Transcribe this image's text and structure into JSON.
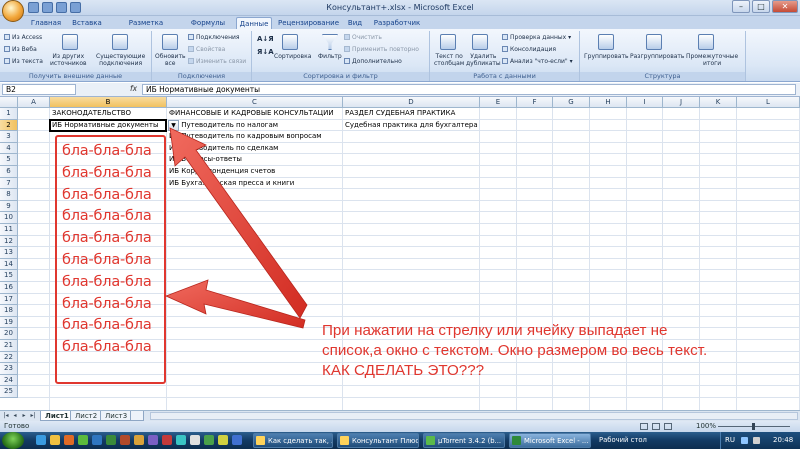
{
  "window": {
    "title": "Консультант+.xlsx - Microsoft Excel",
    "minimize": "–",
    "maximize": "□",
    "close": "✕"
  },
  "ribbon_tabs": [
    "Главная",
    "Вставка",
    "Разметка страницы",
    "Формулы",
    "Данные",
    "Рецензирование",
    "Вид",
    "Разработчик"
  ],
  "ribbon": {
    "get_external": {
      "label": "Получить внешние данные",
      "items": [
        "Из Access",
        "Из Веба",
        "Из текста",
        "Из других\nисточников",
        "Существующие\nподключения"
      ]
    },
    "connections": {
      "label": "Подключения",
      "refresh": "Обновить\nвсе",
      "items": [
        "Подключения",
        "Свойства",
        "Изменить связи"
      ]
    },
    "sort_filter": {
      "label": "Сортировка и фильтр",
      "sort": "Сортировка",
      "filter": "Фильтр",
      "items": [
        "Очистить",
        "Применить повторно",
        "Дополнительно"
      ]
    },
    "data_tools": {
      "label": "Работа с данными",
      "text_to_cols": "Текст по\nстолбцам",
      "remove_dup": "Удалить\nдубликаты",
      "items": [
        "Проверка данных",
        "Консолидация",
        "Анализ \"что-если\""
      ]
    },
    "outline": {
      "label": "Структура",
      "group": "Группировать",
      "ungroup": "Разгруппировать",
      "subtotal": "Промежуточные\nитоги"
    }
  },
  "formula_bar": {
    "name_box": "B2",
    "fx": "fx",
    "formula": "ИБ Нормативные документы"
  },
  "columns": [
    "A",
    "B",
    "C",
    "D",
    "E",
    "F",
    "G",
    "H",
    "I",
    "J",
    "K",
    "L"
  ],
  "rows": [
    "1",
    "2",
    "3",
    "4",
    "5",
    "6",
    "7",
    "8",
    "9",
    "10",
    "11",
    "12",
    "13",
    "14",
    "15",
    "16",
    "17",
    "18",
    "19",
    "20",
    "21",
    "22",
    "23",
    "24",
    "25"
  ],
  "cells": {
    "B1": "ЗАКОНОДАТЕЛЬСТВО",
    "C1": "ФИНАНСОВЫЕ И КАДРОВЫЕ КОНСУЛЬТАЦИИ",
    "D1": "РАЗДЕЛ СУДЕБНАЯ ПРАКТИКА",
    "B2": "ИБ Нормативные документы",
    "C2": "ИБ Путеводитель по налогам",
    "D2": "Судебная практика для бухгалтера",
    "C3": "ИБ Путеводитель по кадровым вопросам",
    "C4": "ИБ Путеводитель по сделкам",
    "C5": "ИБ Вопросы-ответы",
    "C6": "ИБ Корреспонденция счетов",
    "C7": "ИБ Бухгалтерская пресса и книги"
  },
  "annotation": {
    "bla": "бла-бла-бла",
    "note_lines": [
      "При нажатии на стрелку или ячейку выпадает не",
      "список,а окно с текстом. Окно размером во весь текст.",
      "КАК СДЕЛАТЬ ЭТО???"
    ],
    "color": "#e0372f"
  },
  "sheets": [
    "Лист1",
    "Лист2",
    "Лист3"
  ],
  "status": {
    "ready": "Готово",
    "zoom": "100%"
  },
  "taskbar": {
    "items": [
      "Как сделать так, ...",
      "Консультант Плюс",
      "µTorrent 3.4.2  (b...",
      "Microsoft Excel - ..."
    ],
    "desktop": "Рабочий стол",
    "lang": "RU",
    "clock": "20:48"
  }
}
